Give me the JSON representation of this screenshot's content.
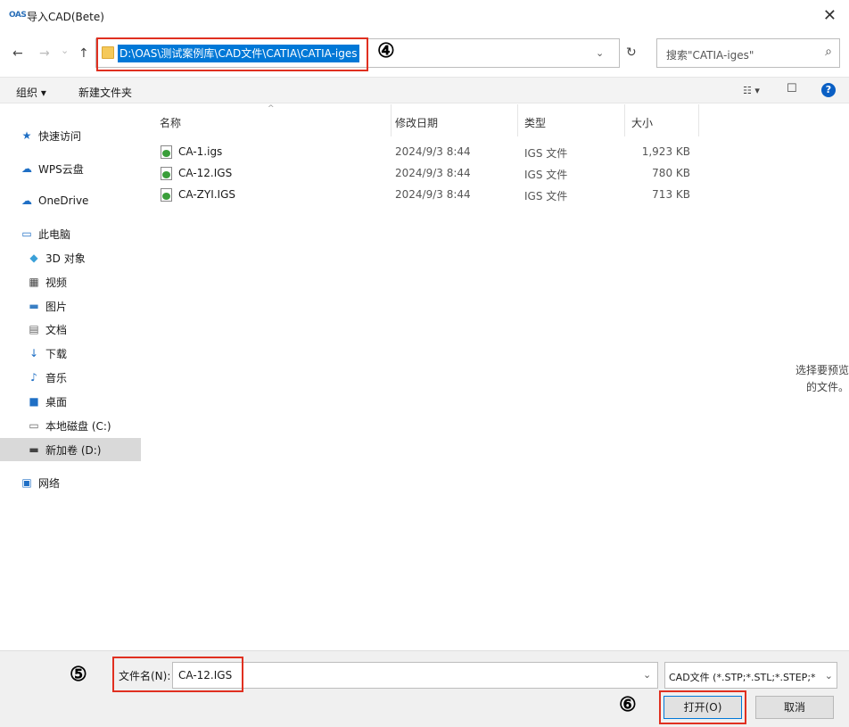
{
  "window": {
    "logo_text": "OAS",
    "title": "导入CAD(Bete)",
    "close_glyph": "✕"
  },
  "nav": {
    "back": "←",
    "forward": "→",
    "recent": "⌄",
    "up": "↑",
    "refresh": "↻",
    "dropdown": "⌄"
  },
  "address": {
    "path": "D:\\OAS\\测试案例库\\CAD文件\\CATIA\\CATIA-iges"
  },
  "search": {
    "placeholder": "搜索\"CATIA-iges\"",
    "icon": "⌕"
  },
  "annotations": {
    "step4": "④",
    "step5": "⑤",
    "step6": "⑥"
  },
  "toolbar": {
    "organize": "组织 ▾",
    "new_folder": "新建文件夹",
    "view_icon": "☷ ▾",
    "pane_icon": "☐",
    "help": "?"
  },
  "sidebar": {
    "items": [
      {
        "label": "快速访问",
        "icon": "★",
        "color": "#1f6fc5"
      },
      {
        "label": "WPS云盘",
        "icon": "☁",
        "color": "#1f6fc5"
      },
      {
        "label": "OneDrive",
        "icon": "☁",
        "color": "#1f6fc5"
      },
      {
        "label": "此电脑",
        "icon": "▭",
        "color": "#1f6fc5"
      },
      {
        "label": "3D 对象",
        "icon": "◆",
        "color": "#3aa0d8"
      },
      {
        "label": "视频",
        "icon": "▦",
        "color": "#444"
      },
      {
        "label": "图片",
        "icon": "▬",
        "color": "#3a7fc4"
      },
      {
        "label": "文档",
        "icon": "▤",
        "color": "#666"
      },
      {
        "label": "下载",
        "icon": "↓",
        "color": "#1f6fc5"
      },
      {
        "label": "音乐",
        "icon": "♪",
        "color": "#1f6fc5"
      },
      {
        "label": "桌面",
        "icon": "■",
        "color": "#1f6fc5"
      },
      {
        "label": "本地磁盘 (C:)",
        "icon": "▭",
        "color": "#666"
      },
      {
        "label": "新加卷 (D:)",
        "icon": "▬",
        "color": "#444"
      },
      {
        "label": "网络",
        "icon": "▣",
        "color": "#1f6fc5"
      }
    ]
  },
  "columns": {
    "name": "名称",
    "date": "修改日期",
    "type": "类型",
    "size": "大小",
    "sort_glyph": "^"
  },
  "files": [
    {
      "name": "CA-1.igs",
      "date": "2024/9/3 8:44",
      "type": "IGS 文件",
      "size": "1,923 KB"
    },
    {
      "name": "CA-12.IGS",
      "date": "2024/9/3 8:44",
      "type": "IGS 文件",
      "size": "780 KB"
    },
    {
      "name": "CA-ZYI.IGS",
      "date": "2024/9/3 8:44",
      "type": "IGS 文件",
      "size": "713 KB"
    }
  ],
  "preview": {
    "line1": "选择要预览",
    "line2": "的文件。"
  },
  "footer": {
    "filename_label": "文件名(N):",
    "filename_value": "CA-12.IGS",
    "dropdown": "⌄",
    "filter": "CAD文件 (*.STP;*.STL;*.STEP;*",
    "open": "打开(O)",
    "cancel": "取消"
  }
}
